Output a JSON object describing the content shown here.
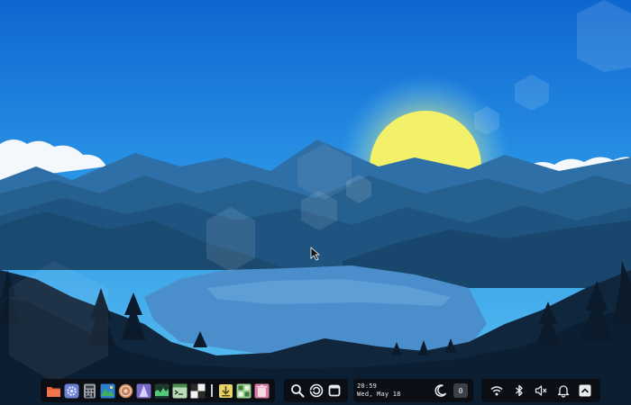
{
  "desktop": {
    "colors": {
      "sky_top": "#0f6ad3",
      "sky_bottom": "#47b2ee",
      "sun": "#f3f06a",
      "lake": "#4a8fcc"
    }
  },
  "taskbar": {
    "apps": [
      {
        "name": "files-app-icon"
      },
      {
        "name": "settings-app-icon"
      },
      {
        "name": "calculator-app-icon"
      },
      {
        "name": "image-viewer-app-icon"
      },
      {
        "name": "disks-app-icon"
      },
      {
        "name": "vlc-app-icon"
      },
      {
        "name": "system-monitor-app-icon"
      },
      {
        "name": "terminal-app-icon"
      },
      {
        "name": "chess-app-icon"
      },
      {
        "name": "downloads-app-icon"
      },
      {
        "name": "puzzle-app-icon"
      },
      {
        "name": "trash-app-icon"
      }
    ],
    "clock": {
      "time": "20:59",
      "date": "Wed, May 18"
    },
    "notifications": {
      "count": "0"
    },
    "tray_icons": [
      "wifi-icon",
      "bluetooth-icon",
      "volume-muted-icon",
      "bell-icon",
      "chevron-up-icon"
    ]
  }
}
